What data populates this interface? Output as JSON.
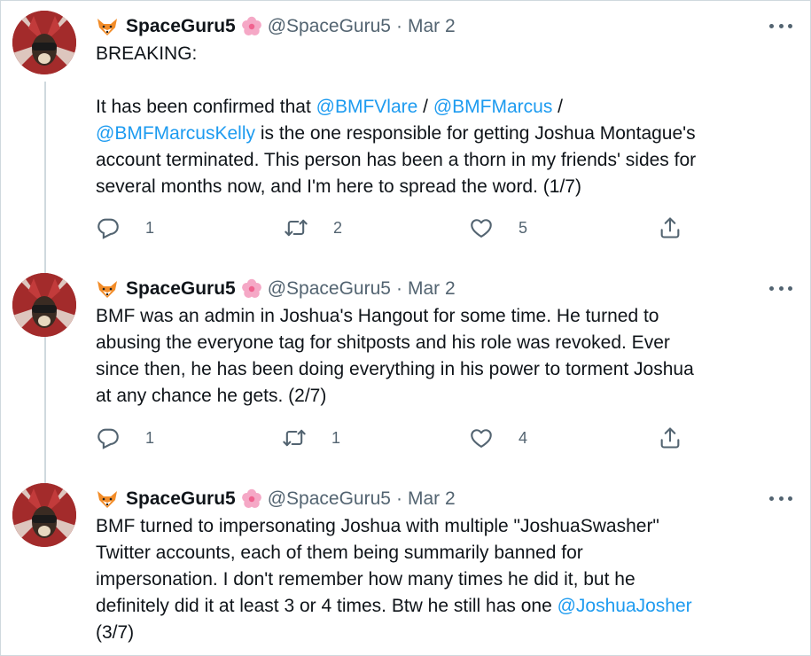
{
  "tweets": [
    {
      "name": "SpaceGuru5",
      "handle": "@SpaceGuru5",
      "separator": "·",
      "date": "Mar 2",
      "text_parts": [
        {
          "t": "BREAKING:\n\nIt has been confirmed that "
        },
        {
          "t": "@BMFVlare",
          "mention": true
        },
        {
          "t": " / "
        },
        {
          "t": "@BMFMarcus",
          "mention": true
        },
        {
          "t": " /\n"
        },
        {
          "t": "@BMFMarcusKelly",
          "mention": true
        },
        {
          "t": " is the one responsible for getting Joshua Montague's\naccount terminated. This person has been a thorn in my friends' sides for\nseveral months now, and I'm here to spread the word. (1/7)"
        }
      ],
      "replies": "1",
      "retweets": "2",
      "likes": "5"
    },
    {
      "name": "SpaceGuru5",
      "handle": "@SpaceGuru5",
      "separator": "·",
      "date": "Mar 2",
      "text_parts": [
        {
          "t": "BMF was an admin in Joshua's Hangout for some time. He turned to\nabusing the everyone tag for shitposts and his role was revoked. Ever\nsince then, he has been doing everything in his power to torment Joshua\nat any chance he gets. (2/7)"
        }
      ],
      "replies": "1",
      "retweets": "1",
      "likes": "4"
    },
    {
      "name": "SpaceGuru5",
      "handle": "@SpaceGuru5",
      "separator": "·",
      "date": "Mar 2",
      "text_parts": [
        {
          "t": "BMF turned to impersonating Joshua with multiple \"JoshuaSwasher\"\nTwitter accounts, each of them being summarily banned for\nimpersonation. I don't remember how many times he did it, but he\ndefinitely did it at least 3 or 4 times. Btw he still has one "
        },
        {
          "t": "@JoshuaJosher",
          "mention": true
        },
        {
          "t": "\n(3/7)"
        }
      ]
    }
  ],
  "icons": {
    "reply": "reply-icon",
    "retweet": "retweet-icon",
    "like": "heart-icon",
    "share": "share-icon",
    "more": "more-icon",
    "emoji_fox": "fox-emoji-icon",
    "emoji_flower": "cherry-blossom-emoji-icon"
  },
  "colors": {
    "text": "#0f1419",
    "secondary": "#536471",
    "mention": "#1d9bf0",
    "thread_line": "#cfd9de"
  }
}
